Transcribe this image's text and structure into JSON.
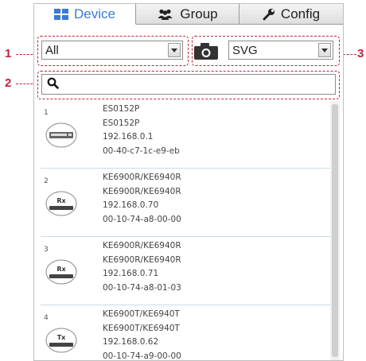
{
  "callouts": [
    "1",
    "2",
    "3"
  ],
  "tabs": {
    "device": {
      "label": "Device",
      "color": "#3a7bd5"
    },
    "group": {
      "label": "Group"
    },
    "config": {
      "label": "Config"
    }
  },
  "filter": {
    "selected": "All"
  },
  "format": {
    "selected": "SVG"
  },
  "search": {
    "value": ""
  },
  "devices": [
    {
      "num": "1",
      "icon": "switch",
      "name": "ES0152P",
      "model": "ES0152P",
      "ip": "192.168.0.1",
      "mac": "00-40-c7-1c-e9-eb"
    },
    {
      "num": "2",
      "icon": "rx",
      "icon_label": "Rx",
      "name": "KE6900R/KE6940R",
      "model": "KE6900R/KE6940R",
      "ip": "192.168.0.70",
      "mac": "00-10-74-a8-00-00"
    },
    {
      "num": "3",
      "icon": "rx",
      "icon_label": "Rx",
      "name": "KE6900R/KE6940R",
      "model": "KE6900R/KE6940R",
      "ip": "192.168.0.71",
      "mac": "00-10-74-a8-01-03"
    },
    {
      "num": "4",
      "icon": "tx",
      "icon_label": "Tx",
      "name": "KE6900T/KE6940T",
      "model": "KE6900T/KE6940T",
      "ip": "192.168.0.62",
      "mac": "00-10-74-a9-00-00"
    }
  ],
  "colors": {
    "callout": "#c0233a",
    "row_divider": "#c9dbe9"
  }
}
